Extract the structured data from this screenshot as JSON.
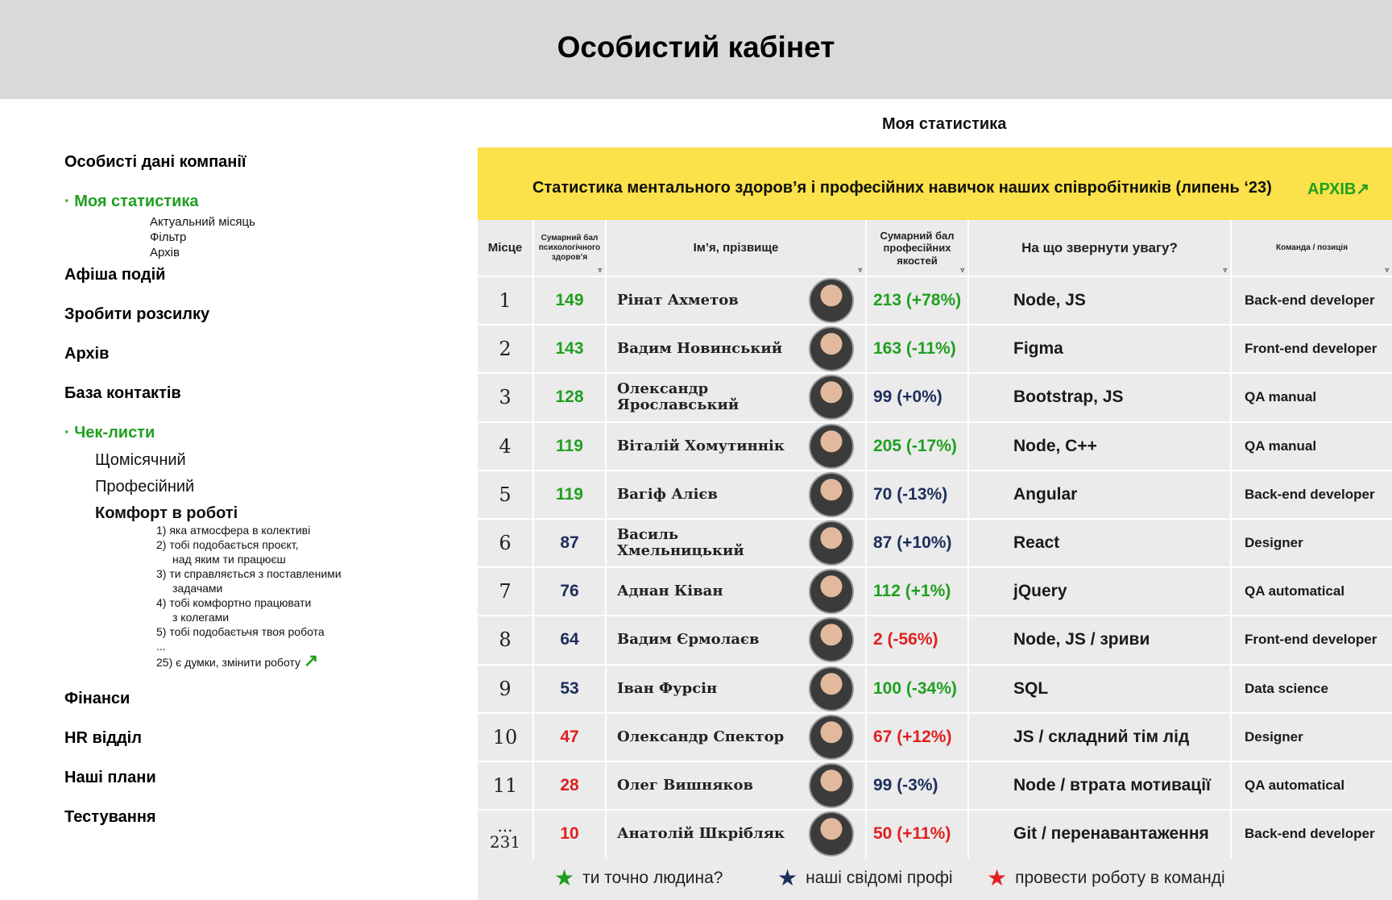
{
  "header": {
    "title": "Особистий кабінет"
  },
  "sidebar": {
    "items": [
      {
        "label": "Особисті дані компанії"
      },
      {
        "label": "· Моя статистика"
      },
      {
        "label": "Афіша подій"
      },
      {
        "label": "Зробити розсилку"
      },
      {
        "label": "Архів"
      },
      {
        "label": "База контактів"
      },
      {
        "label": "· Чек-листи"
      },
      {
        "label": "Фінанси"
      },
      {
        "label": "HR відділ"
      },
      {
        "label": "Наші плани"
      },
      {
        "label": "Тестування"
      }
    ],
    "stat_sub": [
      "Актуальний місяць",
      "Фільтр",
      "Архів"
    ],
    "checklist_sub": [
      "Щомісячний",
      "Професійний",
      "Комфорт в роботі"
    ],
    "comfort_questions": [
      "1) яка атмосфера в колективі",
      "2) тобі подобається проєкт,",
      "над яким ти працюєш",
      "3) ти справляється з поставленими",
      "задачами",
      "4) тобі комфортно працювати",
      "з колегами",
      "5) тобі подобаєтьчя твоя робота",
      "...",
      "25) є думки, змінити роботу"
    ],
    "arrow_icon": "↗"
  },
  "stats": {
    "section_title": "Моя статистика",
    "banner": "Статистика ментального здоров’я і професійних навичок наших співробітників (липень ‘23)",
    "archive_link": "АРХІВ",
    "archive_icon": "↗",
    "columns": {
      "place": "Місце",
      "psych": "Сумарний бал психологічного здоров’я",
      "name": "Ім’я, прізвище",
      "qual": "Сумарний бал професійних якостей",
      "focus": "На що звернути увагу?",
      "team": "Команда / позиція"
    },
    "filter_icon": "▿",
    "rows": [
      {
        "place": "1",
        "psych": "149",
        "psych_level": "green",
        "name": "Рінат Ахметов",
        "qual": "213 (+78%)",
        "qual_level": "green",
        "focus": "Node, JS",
        "team": "Back-end developer"
      },
      {
        "place": "2",
        "psych": "143",
        "psych_level": "green",
        "name": "Вадим Новинський",
        "qual": "163 (-11%)",
        "qual_level": "green",
        "focus": "Figma",
        "team": "Front-end developer"
      },
      {
        "place": "3",
        "psych": "128",
        "psych_level": "green",
        "name": "Олександр Ярославський",
        "qual": "99 (+0%)",
        "qual_level": "navy",
        "focus": "Bootstrap, JS",
        "team": "QA manual"
      },
      {
        "place": "4",
        "psych": "119",
        "psych_level": "green",
        "name": "Віталій Хомутиннік",
        "qual": "205 (-17%)",
        "qual_level": "green",
        "focus": "Node, C++",
        "team": "QA manual"
      },
      {
        "place": "5",
        "psych": "119",
        "psych_level": "green",
        "name": "Вагіф Алієв",
        "qual": "70 (-13%)",
        "qual_level": "navy",
        "focus": "Angular",
        "team": "Back-end developer"
      },
      {
        "place": "6",
        "psych": "87",
        "psych_level": "navy",
        "name": "Василь Хмельницький",
        "qual": "87 (+10%)",
        "qual_level": "navy",
        "focus": "React",
        "team": "Designer"
      },
      {
        "place": "7",
        "psych": "76",
        "psych_level": "navy",
        "name": "Аднан Ківан",
        "qual": "112 (+1%)",
        "qual_level": "green",
        "focus": "jQuery",
        "team": "QA automatical"
      },
      {
        "place": "8",
        "psych": "64",
        "psych_level": "navy",
        "name": "Вадим Єрмолаєв",
        "qual": "2 (-56%)",
        "qual_level": "red",
        "focus": "Node, JS / зриви",
        "team": "Front-end developer"
      },
      {
        "place": "9",
        "psych": "53",
        "psych_level": "navy",
        "name": "Іван Фурсін",
        "qual": "100 (-34%)",
        "qual_level": "green",
        "focus": "SQL",
        "team": "Data science"
      },
      {
        "place": "10",
        "psych": "47",
        "psych_level": "red",
        "name": "Олександр Спектор",
        "qual": "67 (+12%)",
        "qual_level": "red",
        "focus": "JS / складний тім лід",
        "team": "Designer"
      },
      {
        "place": "11",
        "psych": "28",
        "psych_level": "red",
        "name": "Олег Вишняков",
        "qual": "99 (-3%)",
        "qual_level": "navy",
        "focus": "Node / втрата мотивації",
        "team": "QA automatical"
      },
      {
        "place": "...\n231",
        "psych": "10",
        "psych_level": "red",
        "name": "Анатолій Шкрібляк",
        "qual": "50 (+11%)",
        "qual_level": "red",
        "focus": "Git / перенавантаження",
        "team": "Back-end developer"
      }
    ],
    "legend": [
      {
        "label": "ти точно людина?",
        "color": "#1fa01f",
        "icon": "★"
      },
      {
        "label": "наші свідомі профі",
        "color": "#1d2e5c",
        "icon": "★"
      },
      {
        "label": "провести роботу в команді",
        "color": "#e02020",
        "icon": "★"
      }
    ]
  }
}
